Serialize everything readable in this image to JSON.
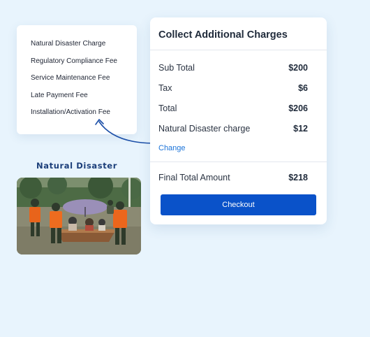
{
  "options_list": {
    "items": [
      "Natural Disaster Charge",
      "Regulatory Compliance Fee",
      "Service Maintenance Fee",
      "Late Payment Fee",
      "Installation/Activation Fee"
    ]
  },
  "photo": {
    "caption": "Natural Disaster"
  },
  "charges": {
    "title": "Collect Additional Charges",
    "rows": {
      "subtotal": {
        "label": "Sub Total",
        "amount": "$200"
      },
      "tax": {
        "label": "Tax",
        "amount": "$6"
      },
      "total": {
        "label": "Total",
        "amount": "$206"
      },
      "disaster": {
        "label": "Natural Disaster charge",
        "amount": "$12"
      }
    },
    "change_link": "Change",
    "final": {
      "label": "Final Total Amount",
      "amount": "$218"
    },
    "checkout_label": "Checkout"
  },
  "colors": {
    "background": "#e8f4fd",
    "accent": "#0a52c9",
    "link": "#1a73d9",
    "caption": "#1c3f7a",
    "arrow": "#1c4fa8"
  }
}
